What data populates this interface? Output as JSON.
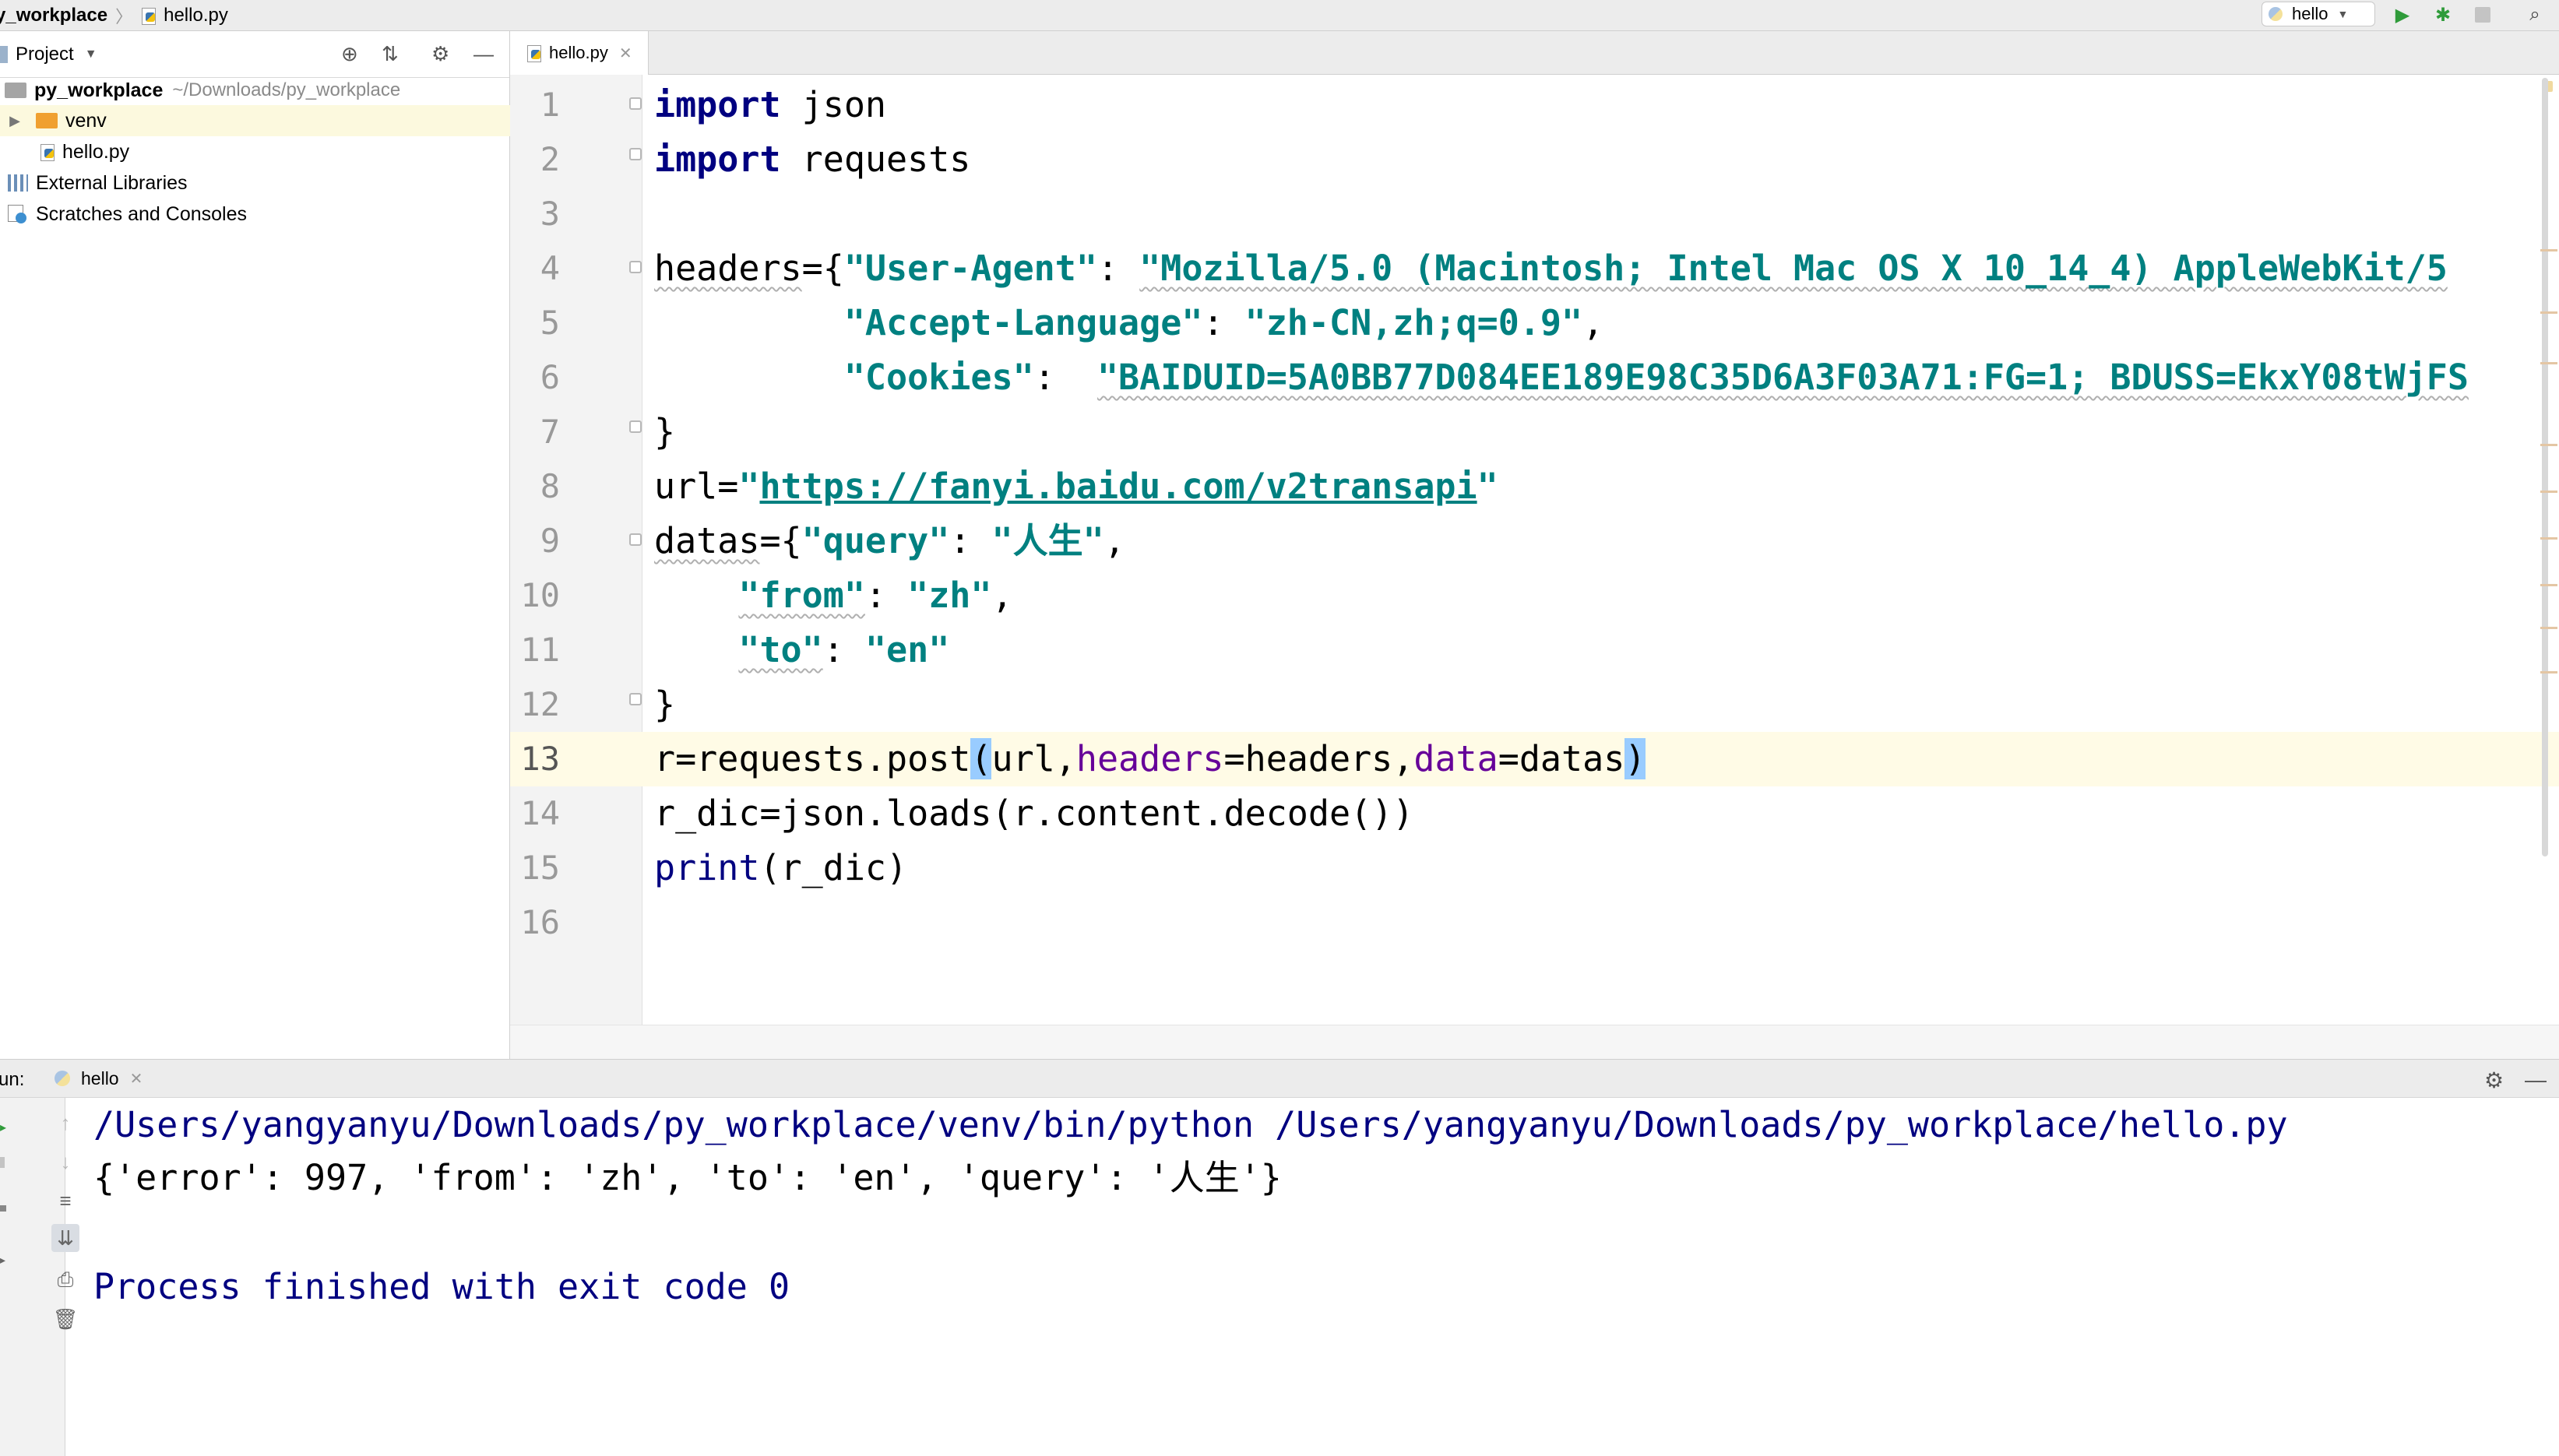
{
  "breadcrumb": {
    "root": "y_workplace",
    "file": "hello.py"
  },
  "toolbar": {
    "run_config": "hello"
  },
  "project": {
    "title": "Project",
    "root_name": "py_workplace",
    "root_path": "~/Downloads/py_workplace",
    "items": [
      {
        "label": "venv"
      },
      {
        "label": "hello.py"
      },
      {
        "label": "External Libraries"
      },
      {
        "label": "Scratches and Consoles"
      }
    ]
  },
  "editor": {
    "tab_label": "hello.py",
    "line_numbers": [
      "1",
      "2",
      "3",
      "4",
      "5",
      "6",
      "7",
      "8",
      "9",
      "10",
      "11",
      "12",
      "13",
      "14",
      "15",
      "16"
    ],
    "current_line": "13",
    "code": {
      "l1_kw": "import",
      "l1_rest": " json",
      "l2_kw": "import",
      "l2_rest": " requests",
      "l4_a": "headers",
      "l4_b": "={",
      "l4_str": "\"User-Agent\"",
      "l4_c": ": ",
      "l4_val": "\"Mozilla/5.0 (Macintosh; Intel Mac OS X 10_14_4) AppleWebKit/5",
      "l5_indent": "         ",
      "l5_str": "\"Accept-Language\"",
      "l5_c": ": ",
      "l5_val": "\"zh-CN,zh;q=0.9\"",
      "l5_end": ",",
      "l6_indent": "         ",
      "l6_str": "\"Cookies\"",
      "l6_c": ":  ",
      "l6_val": "\"BAIDUID=5A0BB77D084EE189E98C35D6A3F03A71:FG=1; BDUSS=EkxY08tWjFS",
      "l7": "}",
      "l8_a": "url=",
      "l8_q1": "\"",
      "l8_link": "https://fanyi.baidu.com/v2transapi",
      "l8_q2": "\"",
      "l9_a": "datas",
      "l9_b": "={",
      "l9_str": "\"query\"",
      "l9_c": ": ",
      "l9_val": "\"人生\"",
      "l9_end": ",",
      "l10_indent": "    ",
      "l10_str": "\"from\"",
      "l10_c": ": ",
      "l10_val": "\"zh\"",
      "l10_end": ",",
      "l11_indent": "    ",
      "l11_str": "\"to\"",
      "l11_c": ": ",
      "l11_val": "\"en\"",
      "l12": "}",
      "l13_a": "r=requests.post",
      "l13_open": "(",
      "l13_b": "url,",
      "l13_p1": "headers",
      "l13_c": "=headers,",
      "l13_p2": "data",
      "l13_d": "=datas",
      "l13_close": ")",
      "l14": "r_dic=json.loads(r.content.decode())",
      "l15_fn": "print",
      "l15_rest": "(r_dic)"
    }
  },
  "run": {
    "label": "un:",
    "tab_label": "hello",
    "console": {
      "command": "/Users/yangyanyu/Downloads/py_workplace/venv/bin/python /Users/yangyanyu/Downloads/py_workplace/hello.py",
      "output": "{'error': 997, 'from': 'zh', 'to': 'en', 'query': '人生'}",
      "exit": "Process finished with exit code 0"
    }
  },
  "icons": {
    "run": "run-icon",
    "debug": "debug-icon",
    "stop": "stop-icon",
    "search": "search-icon",
    "locate": "locate-icon",
    "collapse": "collapse-icon",
    "settings": "gear-icon",
    "minimize": "minimize-icon"
  },
  "colors": {
    "keyword": "#000080",
    "string": "#008080",
    "param": "#660099",
    "current_line": "#fffbe6",
    "brace_highlight": "#99ccff"
  }
}
